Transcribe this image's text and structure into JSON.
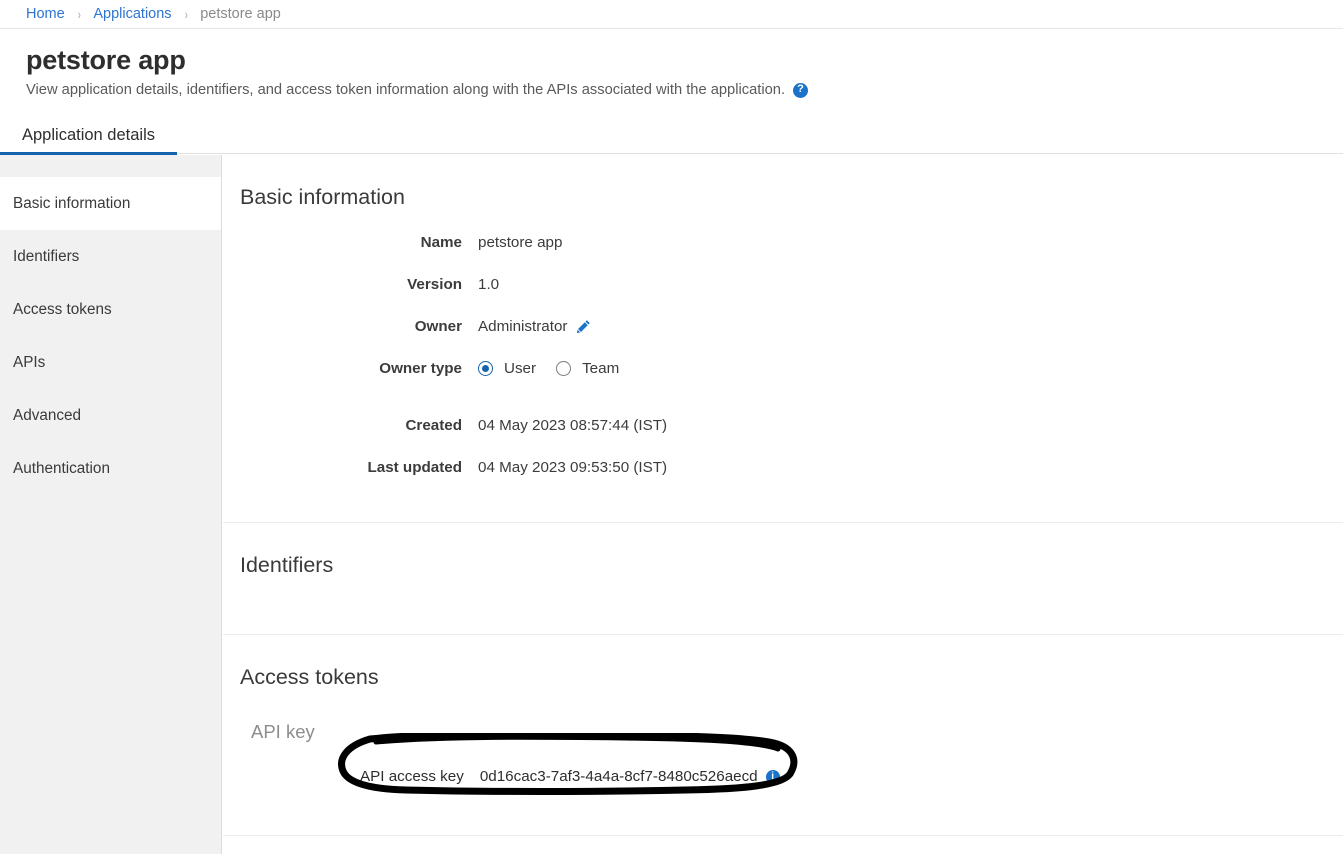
{
  "breadcrumb": {
    "items": [
      {
        "label": "Home",
        "type": "link"
      },
      {
        "label": "Applications",
        "type": "link"
      },
      {
        "label": "petstore app",
        "type": "current"
      }
    ],
    "separator": "›"
  },
  "header": {
    "title": "petstore app",
    "subtitle": "View application details, identifiers, and access token information along with the APIs associated with the application.",
    "help_icon": "help-icon",
    "help_glyph": "?"
  },
  "tabs": [
    {
      "label": "Application details",
      "active": true
    }
  ],
  "sidebar": {
    "items": [
      {
        "label": "Basic information",
        "active": true
      },
      {
        "label": "Identifiers",
        "active": false
      },
      {
        "label": "Access tokens",
        "active": false
      },
      {
        "label": "APIs",
        "active": false
      },
      {
        "label": "Advanced",
        "active": false
      },
      {
        "label": "Authentication",
        "active": false
      }
    ]
  },
  "basic_information": {
    "title": "Basic information",
    "fields": [
      {
        "label": "Name",
        "value": "petstore app"
      },
      {
        "label": "Version",
        "value": "1.0"
      }
    ],
    "owner": {
      "label": "Owner",
      "value": "Administrator",
      "edit_icon": "pencil-icon"
    },
    "owner_type": {
      "label": "Owner type",
      "options": [
        {
          "label": "User",
          "selected": true
        },
        {
          "label": "Team",
          "selected": false
        }
      ]
    },
    "timestamps": [
      {
        "label": "Created",
        "value": "04 May 2023 08:57:44 (IST)"
      },
      {
        "label": "Last updated",
        "value": "04 May 2023 09:53:50 (IST)"
      }
    ]
  },
  "identifiers": {
    "title": "Identifiers"
  },
  "access_tokens": {
    "title": "Access tokens",
    "subtitle": "API key",
    "token_label": "API access key",
    "token_value": "0d16cac3-7af3-4a4a-8cf7-8480c526aecd",
    "info_icon": "info-icon",
    "info_glyph": "i"
  },
  "annotation": {
    "shape": "hand-drawn-ellipse",
    "color": "#000000"
  },
  "colors": {
    "link": "#2f74d0",
    "accent": "#1663ad",
    "icon_blue": "#1a73c8",
    "sidebar_bg": "#f1f1f1",
    "divider": "#ebebeb"
  }
}
